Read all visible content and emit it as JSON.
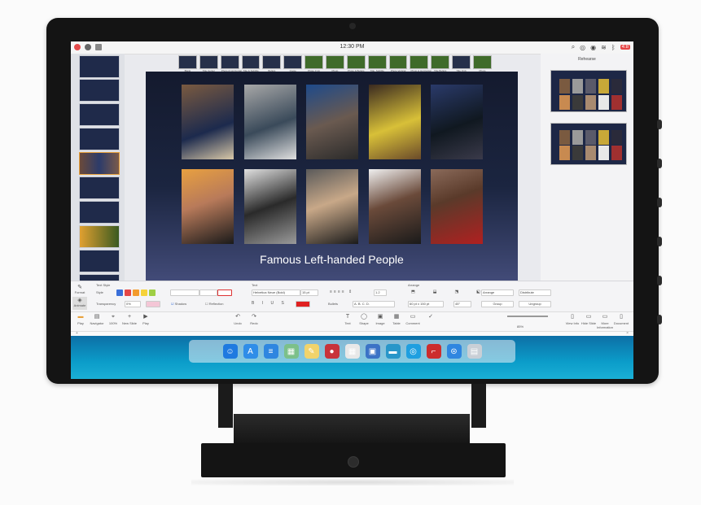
{
  "statusbar": {
    "time": "12:30 PM",
    "icons_right": [
      "search-icon",
      "notification-icon",
      "control-center-icon",
      "wifi-icon",
      "bluetooth-icon",
      "battery-icon"
    ],
    "battery_label": "4:8"
  },
  "layout_strip": {
    "items": [
      {
        "label": "Blank"
      },
      {
        "label": "Title Center"
      },
      {
        "label": "Photo & Horizontal"
      },
      {
        "label": "Title & Subtitle"
      },
      {
        "label": "Bullets"
      },
      {
        "label": "Quote"
      },
      {
        "label": "Photo 3 Up"
      },
      {
        "label": "Photo"
      },
      {
        "label": "Photo & Bullets"
      },
      {
        "label": "Title, Subtitle"
      },
      {
        "label": "Photo Vertical"
      },
      {
        "label": "Photo & Horizontal"
      },
      {
        "label": "Title Bullets"
      },
      {
        "label": "Title Only"
      },
      {
        "label": "Photo"
      }
    ]
  },
  "slide": {
    "title": "Famous Left-handed People"
  },
  "right_panel": {
    "title": "Rehearse"
  },
  "inspector": {
    "text_style_label": "Text Style",
    "style_label": "Style",
    "transparency_label": "Transparency",
    "transparency_value": "0%",
    "shadow_label": "Shadow",
    "reflection_label": "Reflection",
    "font_section_label": "Text",
    "font_name": "Helvetica Neue (Bold)",
    "font_size": "15 pt",
    "line_spacing": "1.2",
    "bullets_label": "Bullets",
    "list_style": "A. B. C. D.",
    "arrange_label": "Arrange",
    "size_value": "60 pt x 150 pt",
    "angle_value": "45°",
    "arrange_options": [
      "Arrange",
      "Distribute"
    ],
    "group_button": "Group",
    "ungroup_button": "Ungroup",
    "left_tabs": [
      "Format",
      "Animate"
    ],
    "accent_colors": [
      "#3a6fd9",
      "#e44747",
      "#f39b2e",
      "#f6d23a",
      "#9fcf45"
    ]
  },
  "toolbar": {
    "left_tools": [
      {
        "label": "Play",
        "icon": "play-icon"
      },
      {
        "label": "Navigator",
        "icon": "navigator-icon"
      },
      {
        "label": "100%",
        "icon": "zoom-icon"
      },
      {
        "label": "New Slide",
        "icon": "plus-icon"
      },
      {
        "label": "Play",
        "icon": "play-triangle-icon"
      }
    ],
    "center_tools": [
      {
        "label": "Undo",
        "icon": "undo-icon"
      },
      {
        "label": "Redo",
        "icon": "redo-icon"
      }
    ],
    "insert_tools": [
      {
        "label": "Text",
        "icon": "text-icon"
      },
      {
        "label": "Shape",
        "icon": "shape-icon"
      },
      {
        "label": "Image",
        "icon": "image-icon"
      },
      {
        "label": "Table",
        "icon": "table-icon"
      },
      {
        "label": "Comment",
        "icon": "comment-icon"
      }
    ],
    "zoom_label": "85%",
    "right_tools": [
      {
        "label": "View Info",
        "icon": "info-icon"
      },
      {
        "label": "Hide Slide",
        "icon": "hide-icon"
      },
      {
        "label": "More Information",
        "icon": "more-icon"
      },
      {
        "label": "Document",
        "icon": "document-icon"
      }
    ]
  },
  "dock": {
    "apps": [
      {
        "name": "finder-icon",
        "color": "#1f7ae0",
        "glyph": "☺"
      },
      {
        "name": "app-store-icon",
        "color": "#2f8de8",
        "glyph": "A"
      },
      {
        "name": "launcher-icon",
        "color": "#2f86e0",
        "glyph": "≡"
      },
      {
        "name": "photos-icon",
        "color": "#7cc08a",
        "glyph": "▦"
      },
      {
        "name": "notes-icon",
        "color": "#f1d36b",
        "glyph": "✎"
      },
      {
        "name": "music-icon",
        "color": "#c8333b",
        "glyph": "●"
      },
      {
        "name": "calendar-icon",
        "color": "#e8e8e8",
        "glyph": "▦"
      },
      {
        "name": "preview-icon",
        "color": "#3b73c6",
        "glyph": "▣"
      },
      {
        "name": "folder-icon",
        "color": "#2896c9",
        "glyph": "▬"
      },
      {
        "name": "browser-icon",
        "color": "#1f9fe0",
        "glyph": "◎"
      },
      {
        "name": "presentation-icon",
        "color": "#cc2d2d",
        "glyph": "⌐"
      },
      {
        "name": "mail-icon",
        "color": "#2f86e0",
        "glyph": "⊜"
      },
      {
        "name": "trash-icon",
        "color": "#c9cfd6",
        "glyph": "▤"
      }
    ]
  }
}
